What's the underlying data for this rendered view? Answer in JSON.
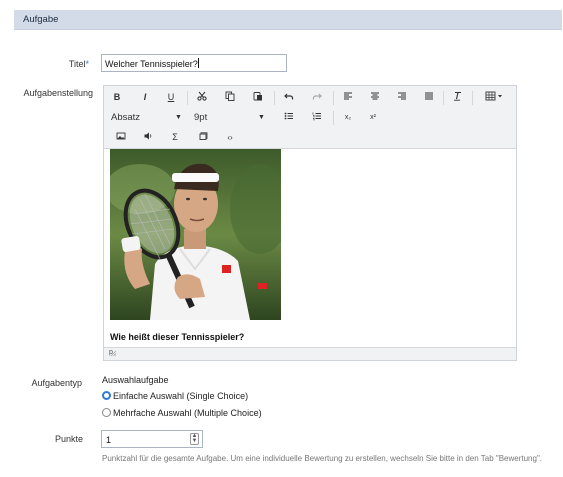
{
  "section": {
    "title": "Aufgabe"
  },
  "fields": {
    "title_label": "Titel",
    "required_marker": "*",
    "title_value": "Welcher Tennisspieler?",
    "description_label": "Aufgabenstellung",
    "type_label": "Aufgabentyp",
    "type_value": "Auswahlaufgabe",
    "points_label": "Punkte",
    "points_value": "1",
    "points_hint": "Punktzahl für die gesamte Aufgabe. Um eine individuelle Bewertung zu erstellen, wechseln Sie bitte in den Tab \"Bewertung\"."
  },
  "editor": {
    "toolbar": {
      "bold": "B",
      "italic": "I",
      "underline": "U",
      "format_select": "Absatz",
      "size_select": "9pt",
      "sum_symbol": "Σ",
      "code_symbol": "‹›",
      "subscript": "x₂",
      "superscript": "x²"
    },
    "question_text": "Wie heißt dieser Tennisspieler?",
    "status_path": "p"
  },
  "choices": [
    {
      "label": "Einfache Auswahl (Single Choice)",
      "checked": true
    },
    {
      "label": "Mehrfache Auswahl (Multiple Choice)",
      "checked": false
    }
  ],
  "colors": {
    "accent": "#2f7bd6",
    "header_bg": "#d3dbe8"
  },
  "icons": [
    "cut-icon",
    "copy-icon",
    "paste-icon",
    "undo-icon",
    "redo-icon",
    "align-left-icon",
    "align-center-icon",
    "align-right-icon",
    "align-justify-icon",
    "clear-format-icon",
    "table-icon",
    "bullet-list-icon",
    "numbered-list-icon",
    "image-icon",
    "audio-icon",
    "sigma-icon",
    "snippet-icon",
    "source-code-icon",
    "resize-icon",
    "spinner-icon"
  ]
}
